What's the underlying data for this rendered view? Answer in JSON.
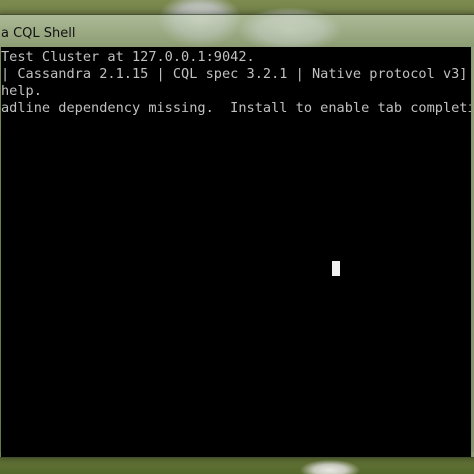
{
  "window": {
    "title": "a CQL Shell"
  },
  "console": {
    "lines": [
      "Test Cluster at 127.0.0.1:9042.",
      "| Cassandra 2.1.15 | CQL spec 3.2.1 | Native protocol v3]",
      "help.",
      "adline dependency missing.  Install to enable tab completi"
    ]
  },
  "colors": {
    "console_background": "#000000",
    "console_text": "#c0c0c0",
    "cursor": "#f0f0f0"
  }
}
